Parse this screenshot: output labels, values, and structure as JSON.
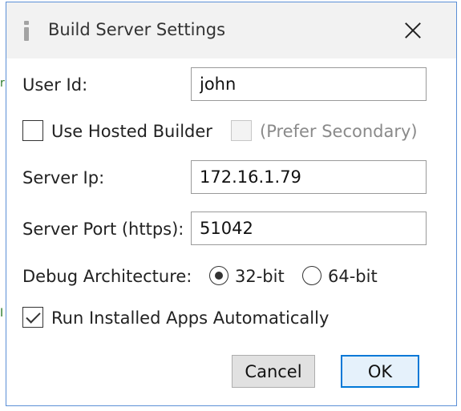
{
  "dialog": {
    "title": "Build Server Settings",
    "app_icon": "info-i-icon",
    "close_icon": "close-x-icon"
  },
  "backdrop": {
    "glyph_top": "r",
    "glyph_bottom": "I"
  },
  "form": {
    "user_id": {
      "label": "User Id:",
      "value": "john"
    },
    "use_hosted_builder": {
      "label": "Use Hosted Builder",
      "checked": false
    },
    "prefer_secondary": {
      "label": "(Prefer Secondary)",
      "checked": false,
      "enabled": false
    },
    "server_ip": {
      "label": "Server Ip:",
      "value": "172.16.1.79"
    },
    "server_port": {
      "label": "Server Port (https):",
      "value": "51042"
    },
    "debug_architecture": {
      "label": "Debug Architecture:",
      "options": [
        "32-bit",
        "64-bit"
      ],
      "selected": "32-bit"
    },
    "run_installed_apps": {
      "label": "Run Installed Apps Automatically",
      "checked": true
    }
  },
  "buttons": {
    "cancel": "Cancel",
    "ok": "OK"
  },
  "colors": {
    "accent": "#0078d7",
    "dialog_border": "#5b8fd6",
    "titlebar": "#f2f2f2"
  }
}
